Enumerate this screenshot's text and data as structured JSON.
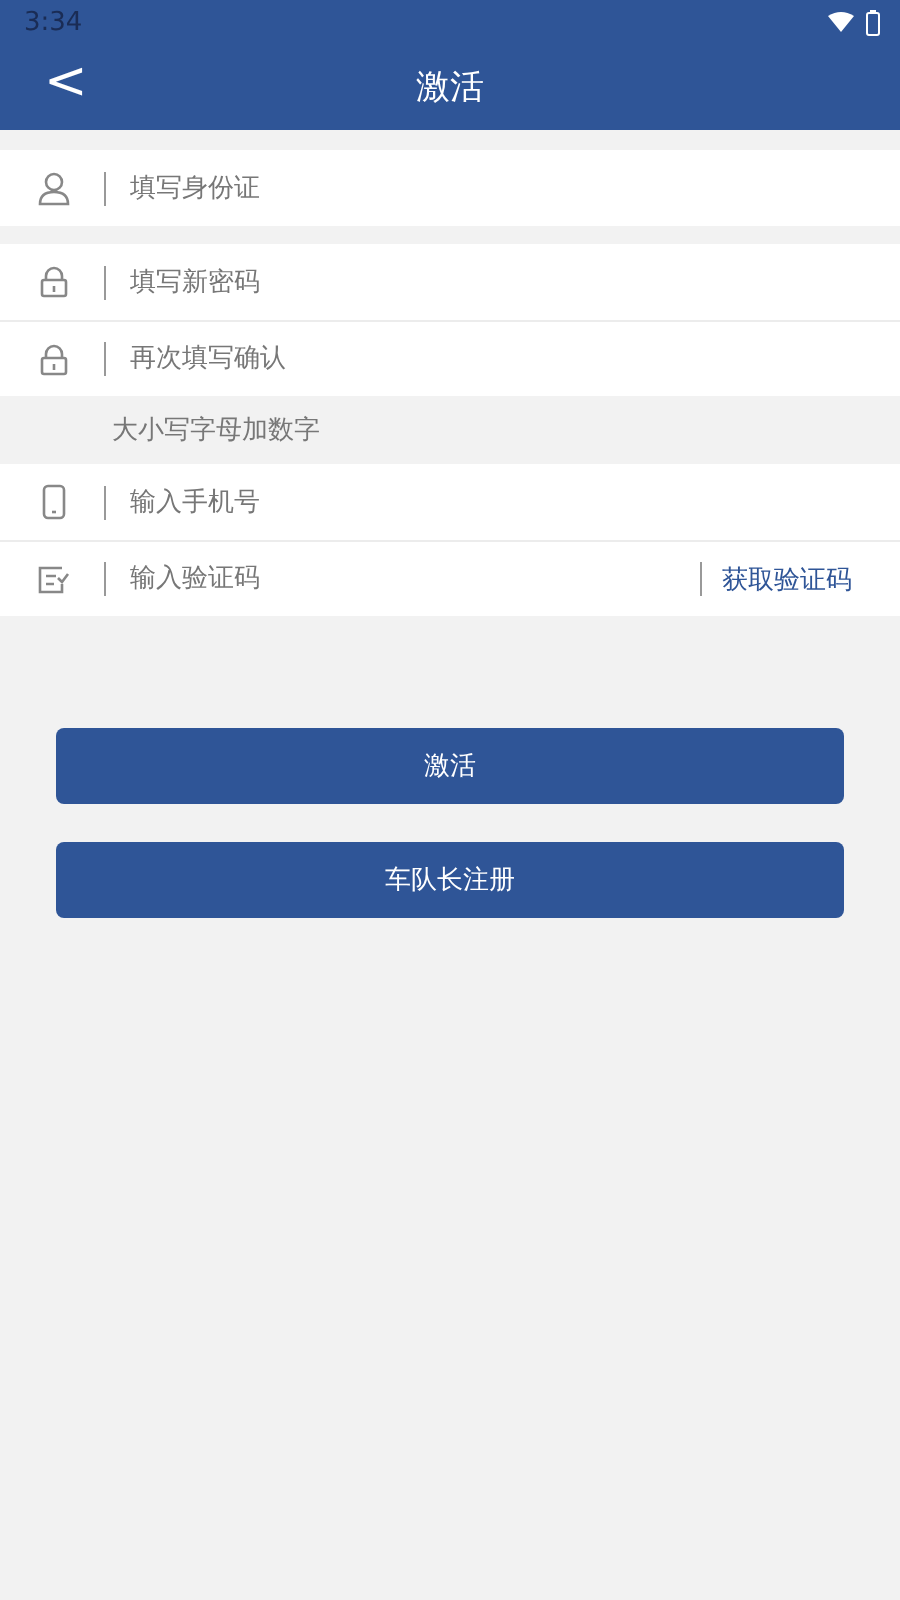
{
  "status_bar": {
    "time": "3:34"
  },
  "header": {
    "back": "<",
    "title": "激活"
  },
  "groups": [
    {
      "fields": [
        {
          "kind": "user",
          "placeholder": "填写身份证"
        }
      ]
    },
    {
      "fields": [
        {
          "kind": "lock",
          "placeholder": "填写新密码"
        },
        {
          "kind": "lock",
          "placeholder": "再次填写确认"
        }
      ],
      "hint": "大小写字母加数字"
    },
    {
      "fields": [
        {
          "kind": "phone",
          "placeholder": "输入手机号"
        },
        {
          "kind": "code",
          "placeholder": "输入验证码",
          "action": "获取验证码"
        }
      ]
    }
  ],
  "buttons": [
    "激活",
    "车队长注册"
  ]
}
